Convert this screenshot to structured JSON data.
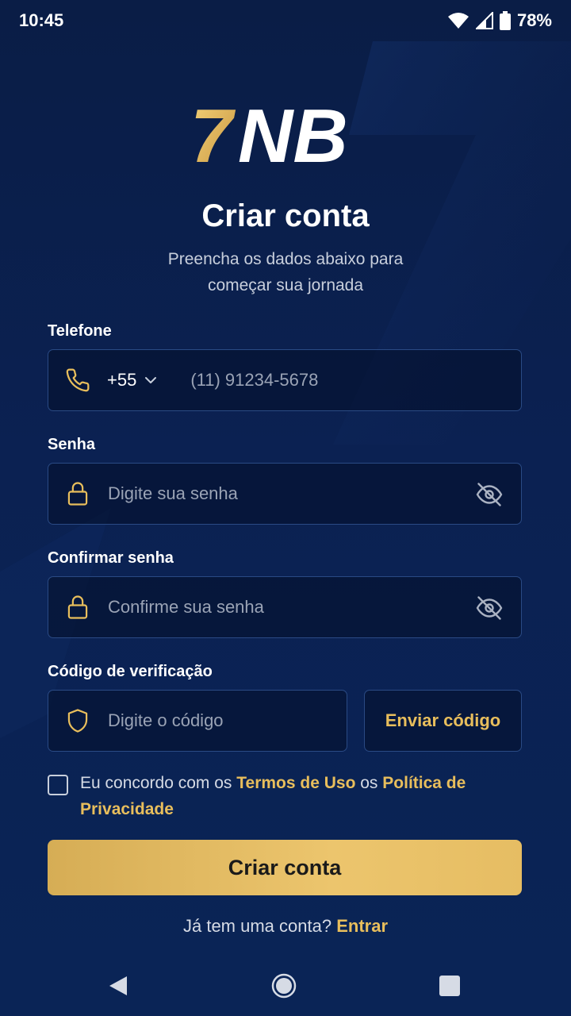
{
  "status_bar": {
    "time": "10:45",
    "battery": "78%",
    "icons": [
      "wifi-icon",
      "signal-icon",
      "battery-icon"
    ]
  },
  "brand": {
    "logo_prefix": "7",
    "logo_text": "NB",
    "gold": "#e8be5c",
    "background": "#0b2152"
  },
  "header": {
    "title": "Criar conta",
    "subtitle_line1": "Preencha os dados abaixo para",
    "subtitle_line2": "começar sua jornada"
  },
  "form": {
    "phone": {
      "label": "Telefone",
      "country_code": "+55",
      "placeholder": "(11) 91234-5678",
      "icon": "phone-icon"
    },
    "password": {
      "label": "Senha",
      "placeholder": "Digite sua senha",
      "icon": "lock-icon"
    },
    "confirm_password": {
      "label": "Confirmar senha",
      "placeholder": "Confirme sua senha",
      "icon": "lock-icon"
    },
    "verification": {
      "label": "Código de verificação",
      "placeholder": "Digite o código",
      "send_label": "Enviar código",
      "icon": "shield-icon"
    },
    "terms": {
      "prefix": "Eu concordo com os ",
      "terms_link": "Termos de Uso",
      "middle": " os ",
      "privacy_link": "Política de Privacidade",
      "checked": false
    },
    "submit_label": "Criar conta"
  },
  "footer": {
    "question": "Já tem uma conta? ",
    "login_link": "Entrar"
  }
}
